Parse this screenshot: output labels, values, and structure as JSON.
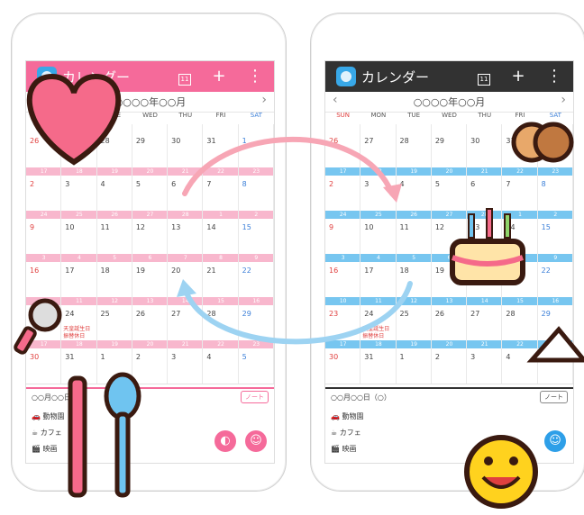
{
  "left": {
    "app_title": "カレンダー",
    "calendar_icon_text": "11",
    "add_icon": "+",
    "more_icon": "⋮",
    "month_label": "○○○○年○○月",
    "prev": "‹",
    "next": "›",
    "weekdays": [
      "SUN",
      "MON",
      "TUE",
      "WED",
      "THU",
      "FRI",
      "SAT"
    ],
    "footer_date": "○○月○○日（○）",
    "note_label": "ノート",
    "footer_items": [
      "動物園",
      "カフェ",
      "映画"
    ],
    "colors": {
      "accent": "#f56a9a",
      "band": "#f8b7cd"
    }
  },
  "right": {
    "app_title": "カレンダー",
    "calendar_icon_text": "11",
    "add_icon": "+",
    "more_icon": "⋮",
    "month_label": "○○○○年○○月",
    "prev": "‹",
    "next": "›",
    "weekdays": [
      "SUN",
      "MON",
      "TUE",
      "WED",
      "THU",
      "FRI",
      "SAT"
    ],
    "footer_date": "○○月○○日（○）",
    "note_label": "ノート",
    "footer_items": [
      "動物園",
      "カフェ",
      "映画"
    ],
    "colors": {
      "accent": "#323232",
      "band": "#77c6f0"
    }
  },
  "weeks": [
    {
      "days": [
        "26",
        "27",
        "28",
        "29",
        "30",
        "31",
        "1"
      ],
      "band": [
        "",
        "",
        "",
        "",
        "",
        "",
        ""
      ]
    },
    {
      "days": [
        "2",
        "3",
        "4",
        "5",
        "6",
        "7",
        "8"
      ],
      "band": [
        "17",
        "18",
        "19",
        "20",
        "21",
        "22",
        "23"
      ]
    },
    {
      "days": [
        "9",
        "10",
        "11",
        "12",
        "13",
        "14",
        "15"
      ],
      "band": [
        "24",
        "25",
        "26",
        "27",
        "28",
        "1",
        "2"
      ]
    },
    {
      "days": [
        "16",
        "17",
        "18",
        "19",
        "20",
        "21",
        "22"
      ],
      "band": [
        "3",
        "4",
        "5",
        "6",
        "7",
        "8",
        "9"
      ]
    },
    {
      "days": [
        "23",
        "24",
        "25",
        "26",
        "27",
        "28",
        "29"
      ],
      "band": [
        "10",
        "11",
        "12",
        "13",
        "14",
        "15",
        "16"
      ]
    },
    {
      "days": [
        "30",
        "31",
        "1",
        "2",
        "3",
        "4",
        "5"
      ],
      "band": [
        "17",
        "18",
        "19",
        "20",
        "21",
        "22",
        "23"
      ]
    }
  ],
  "events": {
    "mon24_a": "天皇誕生日",
    "mon24_b": "振替休日"
  }
}
